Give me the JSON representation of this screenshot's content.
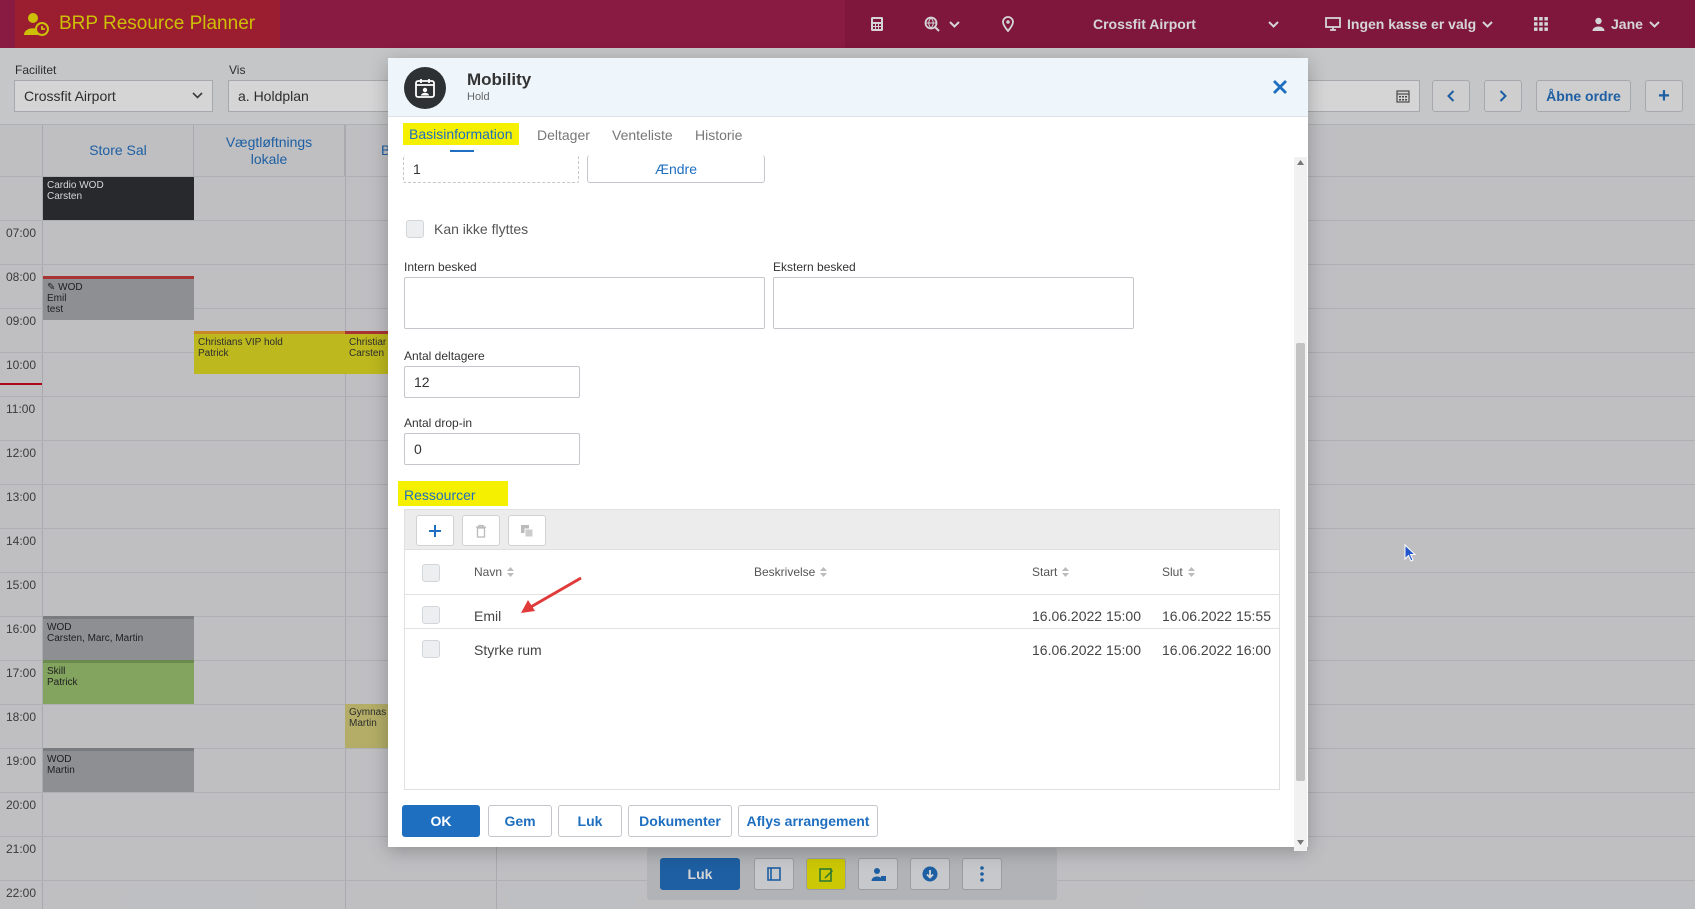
{
  "app": {
    "title": "BRP Resource Planner"
  },
  "header": {
    "location": "Crossfit Airport",
    "register": "Ingen kasse er valg",
    "user": "Jane"
  },
  "filters": {
    "facility_label": "Facilitet",
    "facility_value": "Crossfit Airport",
    "view_label": "Vis",
    "view_value": "a. Holdplan",
    "open_orders": "Åbne ordre",
    "add": "+"
  },
  "calendar": {
    "columns": [
      "Store Sal",
      "Vægtløftnings lokale",
      "B"
    ],
    "times": [
      "07:00",
      "08:00",
      "09:00",
      "10:00",
      "11:00",
      "12:00",
      "13:00",
      "14:00",
      "15:00",
      "16:00",
      "17:00",
      "18:00",
      "19:00",
      "20:00",
      "21:00",
      "22:00"
    ],
    "events": [
      {
        "title": "Cardio WOD",
        "who": "Carsten"
      },
      {
        "title": "WOD",
        "who": "Emil",
        "extra": "test"
      },
      {
        "title": "Christians VIP hold",
        "who": "Patrick"
      },
      {
        "title": "Christiar",
        "who": "Carsten"
      },
      {
        "title": "WOD",
        "who": "Carsten, Marc, Martin"
      },
      {
        "title": "Skill",
        "who": "Patrick"
      },
      {
        "title": "Gymnas",
        "who": "Martin"
      },
      {
        "title": "WOD",
        "who": "Martin"
      }
    ]
  },
  "bottom_bar": {
    "close": "Luk"
  },
  "modal": {
    "title": "Mobility",
    "subtitle": "Hold",
    "tabs": [
      "Basisinformation",
      "Deltager",
      "Venteliste",
      "Historie"
    ],
    "top_field_value": "1",
    "change_button": "Ændre",
    "cannot_move_label": "Kan ikke flyttes",
    "internal_note_label": "Intern besked",
    "external_note_label": "Ekstern besked",
    "participants_label": "Antal deltagere",
    "participants_value": "12",
    "dropin_label": "Antal drop-in",
    "dropin_value": "0",
    "resources_title": "Ressourcer",
    "table": {
      "headers": [
        "Navn",
        "Beskrivelse",
        "Start",
        "Slut"
      ],
      "rows": [
        {
          "name": "Emil",
          "desc": "",
          "start": "16.06.2022 15:00",
          "end": "16.06.2022 15:55"
        },
        {
          "name": "Styrke rum",
          "desc": "",
          "start": "16.06.2022 15:00",
          "end": "16.06.2022 16:00"
        }
      ]
    },
    "footer": {
      "ok": "OK",
      "save": "Gem",
      "close": "Luk",
      "documents": "Dokumenter",
      "cancel_event": "Aflys arrangement"
    }
  },
  "colors": {
    "header": "#a31b4a",
    "brand_text": "#f5e400",
    "primary": "#1f6fc0",
    "highlight": "#f4f000"
  }
}
